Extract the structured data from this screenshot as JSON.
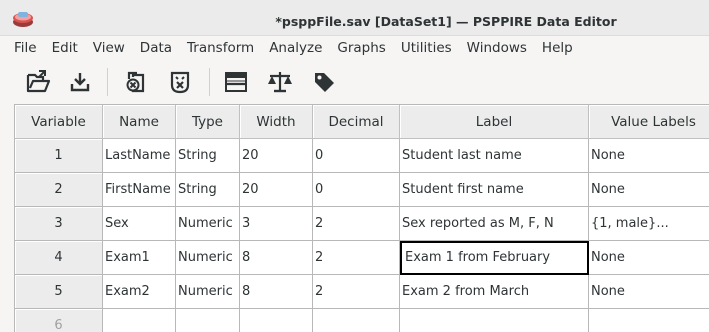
{
  "window": {
    "title": "*psppFile.sav [DataSet1] — PSPPIRE Data Editor"
  },
  "menubar": {
    "items": [
      "File",
      "Edit",
      "View",
      "Data",
      "Transform",
      "Analyze",
      "Graphs",
      "Utilities",
      "Windows",
      "Help"
    ]
  },
  "toolbar": {
    "buttons": [
      {
        "name": "open-file-icon"
      },
      {
        "name": "save-file-icon"
      },
      {
        "name": "goto-case-icon"
      },
      {
        "name": "goto-variable-icon"
      },
      {
        "name": "split-file-icon"
      },
      {
        "name": "weight-cases-icon"
      },
      {
        "name": "value-labels-icon"
      }
    ]
  },
  "grid": {
    "columns": [
      "Variable",
      "Name",
      "Type",
      "Width",
      "Decimal",
      "Label",
      "Value Labels"
    ],
    "rows": [
      {
        "num": "1",
        "cells": [
          "LastName",
          "String",
          "20",
          "0",
          "Student last name",
          "None"
        ]
      },
      {
        "num": "2",
        "cells": [
          "FirstName",
          "String",
          "20",
          "0",
          "Student first name",
          "None"
        ]
      },
      {
        "num": "3",
        "cells": [
          "Sex",
          "Numeric",
          "3",
          "2",
          "Sex reported as M, F, N",
          "{1, male}..."
        ]
      },
      {
        "num": "4",
        "cells": [
          "Exam1",
          "Numeric",
          "8",
          "2",
          "Exam 1 from February",
          "None"
        ]
      },
      {
        "num": "5",
        "cells": [
          "Exam2",
          "Numeric",
          "8",
          "2",
          "Exam 2 from March",
          "None"
        ]
      },
      {
        "num": "6",
        "cells": [
          "",
          "",
          "",
          "",
          "",
          ""
        ]
      }
    ],
    "selected": {
      "row": 3,
      "col": 4
    }
  }
}
